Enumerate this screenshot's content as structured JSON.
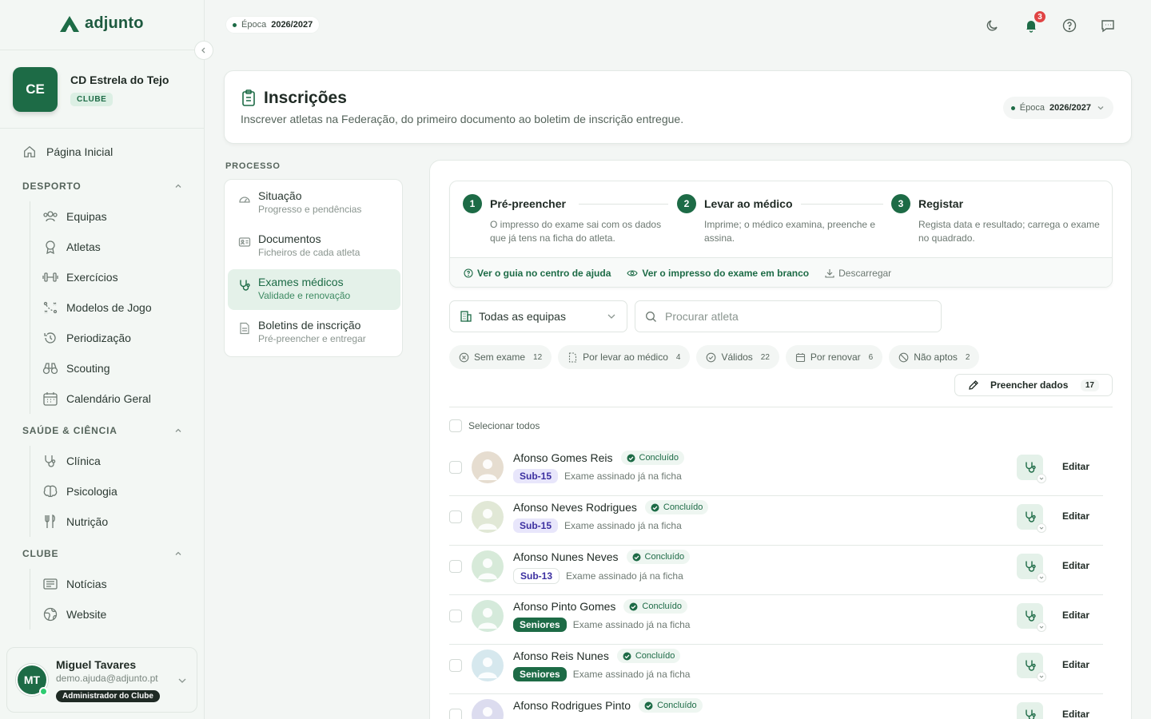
{
  "app": {
    "name": "adjunto"
  },
  "club": {
    "initials": "CE",
    "name": "CD Estrela do Tejo",
    "tag": "CLUBE"
  },
  "nav": {
    "home": "Página Inicial",
    "sections": [
      {
        "title": "DESPORTO",
        "items": [
          "Equipas",
          "Atletas",
          "Exercícios",
          "Modelos de Jogo",
          "Periodização",
          "Scouting",
          "Calendário Geral"
        ]
      },
      {
        "title": "SAÚDE & CIÊNCIA",
        "items": [
          "Clínica",
          "Psicologia",
          "Nutrição"
        ]
      },
      {
        "title": "CLUBE",
        "items": [
          "Notícias",
          "Website"
        ]
      }
    ]
  },
  "user": {
    "initials": "MT",
    "name": "Miguel Tavares",
    "email": "demo.ajuda@adjunto.pt",
    "role": "Administrador do Clube"
  },
  "topbar": {
    "epoca_label": "Época",
    "epoca_value": "2026/2027",
    "notifications": "3"
  },
  "header": {
    "title": "Inscrições",
    "subtitle": "Inscrever atletas na Federação, do primeiro documento ao boletim de inscrição entregue.",
    "epoca_label": "Época",
    "epoca_value": "2026/2027"
  },
  "process": {
    "label": "PROCESSO",
    "items": [
      {
        "title": "Situação",
        "subtitle": "Progresso e pendências",
        "icon": "gauge-icon"
      },
      {
        "title": "Documentos",
        "subtitle": "Ficheiros de cada atleta",
        "icon": "id-card-icon"
      },
      {
        "title": "Exames médicos",
        "subtitle": "Validade e renovação",
        "icon": "stethoscope-icon",
        "active": true
      },
      {
        "title": "Boletins de inscrição",
        "subtitle": "Pré-preencher e entregar",
        "icon": "pdf-icon"
      }
    ]
  },
  "steps": [
    {
      "num": "1",
      "title": "Pré-preencher",
      "desc": "O impresso do exame sai com os dados que já tens na ficha do atleta."
    },
    {
      "num": "2",
      "title": "Levar ao médico",
      "desc": "Imprime; o médico examina, preenche e assina."
    },
    {
      "num": "3",
      "title": "Registar",
      "desc": "Regista data e resultado; carrega o exame no quadrado."
    }
  ],
  "links": {
    "guide": "Ver o guia no centro de ajuda",
    "blank": "Ver o impresso do exame em branco",
    "download": "Descarregar"
  },
  "filters": {
    "team_select": "Todas as equipas",
    "search_placeholder": "Procurar atleta",
    "chips": [
      {
        "label": "Sem exame",
        "count": "12"
      },
      {
        "label": "Por levar ao médico",
        "count": "4"
      },
      {
        "label": "Válidos",
        "count": "22"
      },
      {
        "label": "Por renovar",
        "count": "6"
      },
      {
        "label": "Não aptos",
        "count": "2"
      }
    ],
    "fill_button": "Preencher dados",
    "fill_count": "17"
  },
  "list": {
    "select_all": "Selecionar todos",
    "status_label": "Concluído",
    "edit_label": "Editar",
    "rows": [
      {
        "name": "Afonso Gomes Reis",
        "team": "Sub-15",
        "note": "Exame assinado já na ficha"
      },
      {
        "name": "Afonso Neves Rodrigues",
        "team": "Sub-15",
        "note": "Exame assinado já na ficha"
      },
      {
        "name": "Afonso Nunes Neves",
        "team": "Sub-13",
        "note": "Exame assinado já na ficha"
      },
      {
        "name": "Afonso Pinto Gomes",
        "team": "Seniores",
        "note": "Exame assinado já na ficha"
      },
      {
        "name": "Afonso Reis Nunes",
        "team": "Seniores",
        "note": "Exame assinado já na ficha"
      },
      {
        "name": "Afonso Rodrigues Pinto",
        "team": "",
        "note": ""
      }
    ]
  },
  "colors": {
    "brand": "#1d6b46",
    "accent_light": "#e4f1e9",
    "badge_red": "#e04444"
  }
}
